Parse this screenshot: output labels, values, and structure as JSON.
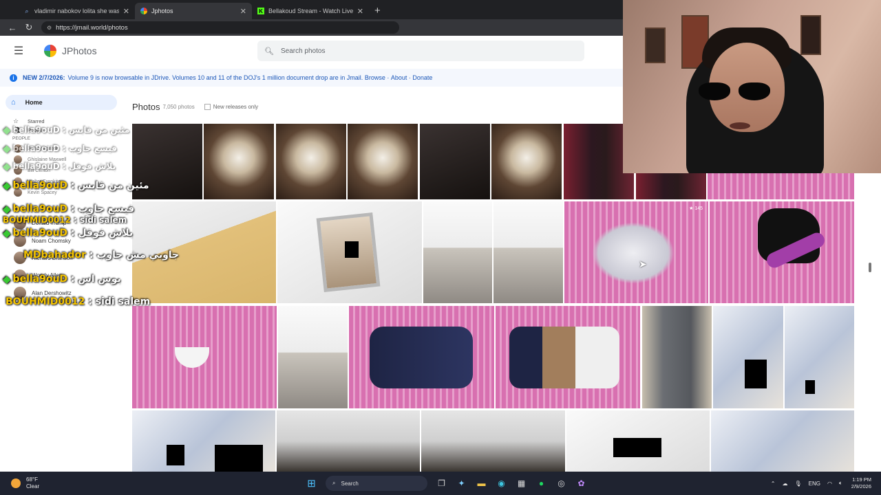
{
  "browser": {
    "tabs": [
      {
        "title": "vladimir nabokov lolita she was lo",
        "icon": "search-icon",
        "active": false
      },
      {
        "title": "Jphotos",
        "icon": "jphotos-favicon",
        "active": true
      },
      {
        "title": "Bellakoud Stream - Watch Live on",
        "icon": "kick-icon",
        "active": false
      }
    ],
    "new_tab": "+",
    "url": "https://jmail.world/photos"
  },
  "app": {
    "brand": "JPhotos",
    "search_placeholder": "Search photos",
    "banner": {
      "date": "NEW 2/7/2026:",
      "text": "Volume 9 is now browsable in JDrive. Volumes 10 and 11 of the DOJ's 1 million document drop are in Jmail.",
      "browse": "Browse",
      "about": "About",
      "donate": "Donate"
    },
    "sidebar": {
      "home": "Home",
      "items": [
        {
          "label": "Starred",
          "icon": "star-icon"
        },
        {
          "label": "People",
          "icon": "people-icon"
        }
      ],
      "section": "PEOPLE",
      "people_faded": [
        "Jeffrey Epstein",
        "Ghislaine Maxwell",
        "Bill Clinton",
        "Walter Cronkite",
        "Kevin Spacey"
      ],
      "people": [
        "Donald Trump",
        "Noam Chomsky",
        "Richard Branson",
        "Woody Allen",
        "Alan Dershowitz"
      ]
    },
    "photos": {
      "title": "Photos",
      "count": "7,050 photos",
      "filter": "New releases only"
    },
    "stack_badge": "★ 145"
  },
  "chat": [
    {
      "user": "bella9ouD",
      "msg": "مئين من قابس",
      "ghost": true
    },
    {
      "user": "bella9ouD",
      "msg": "فيسع جاوب",
      "ghost": true
    },
    {
      "user": "bella9ouD",
      "msg": "بلاش فوقل",
      "ghost": true
    },
    {
      "user": "bella9ouD",
      "msg": "مئين من قابس",
      "ghost": false
    },
    {
      "user": "bella9ouD",
      "msg": "فيسع جاوب",
      "ghost": false
    },
    {
      "user": "BOUHMID0012",
      "msg": "sidi salem",
      "ghost": false
    },
    {
      "user": "bella9ouD",
      "msg": "بلاش فوقل",
      "ghost": false
    },
    {
      "user": "MDbahador",
      "msg": "جاوبي مش جاوب",
      "ghost": false
    },
    {
      "user": "bella9ouD",
      "msg": "بوس اس",
      "ghost": false
    },
    {
      "user": "BOUHMID0012",
      "msg": "sidi salem",
      "ghost": false
    }
  ],
  "taskbar": {
    "temp": "68°F",
    "weather": "Clear",
    "search": "Search",
    "lang": "ENG",
    "time": "1:19 PM",
    "date": "2/9/2026"
  }
}
